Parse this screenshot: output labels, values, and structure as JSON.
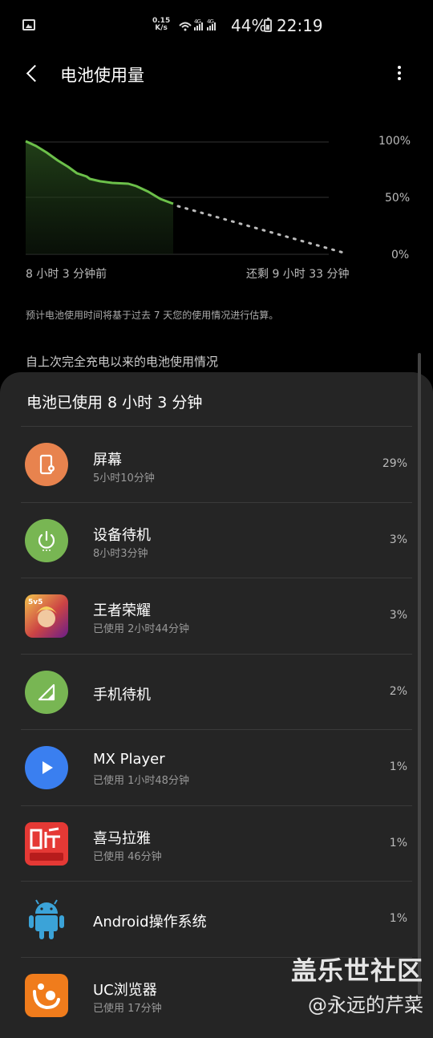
{
  "status_bar": {
    "net_speed_top": "0.15",
    "net_speed_bottom": "K/s",
    "signal": "4G 4G",
    "battery_percent": "44%",
    "time": "22:19"
  },
  "header": {
    "title": "电池使用量"
  },
  "chart": {
    "y_labels": [
      "100%",
      "50%",
      "0%"
    ],
    "x_left": "8 小时 3 分钟前",
    "x_right": "还剩 9 小时 33 分钟",
    "colors": {
      "used": "#6cc04a",
      "projected": "#bbbbbb"
    }
  },
  "note": "预计电池使用时间将基于过去 7 天您的使用情况进行估算。",
  "section_title": "自上次完全充电以来的电池使用情况",
  "summary": "电池已使用 8 小时 3 分钟",
  "items": [
    {
      "name": "屏幕",
      "sub": "5小时10分钟",
      "value": "29%",
      "icon": "screen-icon",
      "color": "#e8834e"
    },
    {
      "name": "设备待机",
      "sub": "8小时3分钟",
      "value": "3%",
      "icon": "power-icon",
      "color": "#78b653"
    },
    {
      "name": "王者荣耀",
      "sub": "已使用 2小时44分钟",
      "value": "3%",
      "icon": "game-icon",
      "color": "#c44"
    },
    {
      "name": "手机待机",
      "sub": "",
      "value": "2%",
      "icon": "signal-icon",
      "color": "#78b653"
    },
    {
      "name": "MX Player",
      "sub": "已使用 1小时48分钟",
      "value": "1%",
      "icon": "play-icon",
      "color": "#3a7ff0"
    },
    {
      "name": "喜马拉雅",
      "sub": "已使用 46分钟",
      "value": "1%",
      "icon": "ximalaya-icon",
      "color": "#e53935"
    },
    {
      "name": "Android操作系统",
      "sub": "",
      "value": "1%",
      "icon": "android-icon",
      "color": "#3ba3d8"
    },
    {
      "name": "UC浏览器",
      "sub": "已使用 17分钟",
      "value": "",
      "icon": "uc-icon",
      "color": "#f07c1c"
    }
  ],
  "watermark": {
    "line1": "盖乐世社区",
    "line2": "@永远的芹菜"
  }
}
